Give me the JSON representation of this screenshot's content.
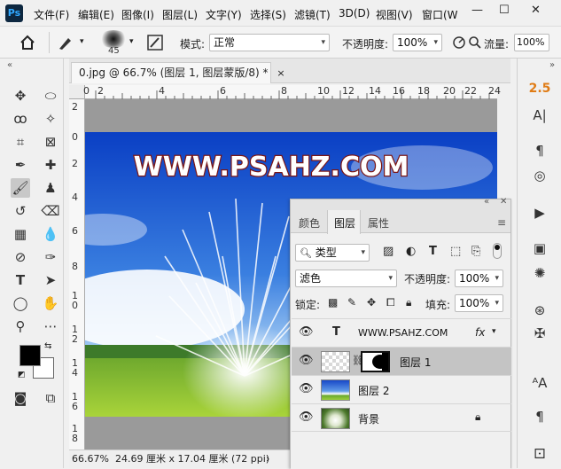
{
  "menubar": {
    "logo": "Ps",
    "items": [
      "文件(F)",
      "编辑(E)",
      "图像(I)",
      "图层(L)",
      "文字(Y)",
      "选择(S)",
      "滤镜(T)",
      "3D(D)",
      "视图(V)",
      "窗口(W"
    ],
    "min": "—",
    "max": "☐",
    "close": "✕"
  },
  "options": {
    "brush_size": "45",
    "mode_label": "模式:",
    "mode_value": "正常",
    "opacity_label": "不透明度:",
    "opacity_value": "100%",
    "flow_label": "流量:",
    "flow_value": "100%"
  },
  "document": {
    "tab_title": "0.jpg @ 66.7% (图层 1, 图层蒙版/8) *",
    "canvas_text": "WWW.PSAHZ.COM",
    "ruler_h": [
      "0",
      "2",
      "4",
      "6",
      "8",
      "10",
      "12",
      "14",
      "16",
      "18",
      "20",
      "22",
      "24"
    ],
    "ruler_v": [
      "2",
      "0",
      "2",
      "4",
      "6",
      "8",
      "1\n0",
      "1\n2",
      "1\n4",
      "1\n6",
      "1\n8"
    ]
  },
  "status": {
    "zoom": "66.67%",
    "info": "24.69 厘米 x 17.04 厘米 (72 ppi)",
    "arrow": "›"
  },
  "right_panel": {
    "value_label": "2.5"
  },
  "layers_panel": {
    "tabs": [
      "颜色",
      "图层",
      "属性"
    ],
    "filter_label": "类型",
    "blend_mode": "滤色",
    "opacity_label": "不透明度:",
    "opacity_value": "100%",
    "lock_label": "锁定:",
    "fill_label": "填充:",
    "fill_value": "100%",
    "layers": [
      {
        "name": "WWW.PSAHZ.COM",
        "kind": "text",
        "fx": "fx"
      },
      {
        "name": "图层 1",
        "kind": "masked",
        "selected": true
      },
      {
        "name": "图层 2",
        "kind": "image"
      },
      {
        "name": "背景",
        "kind": "background",
        "locked": true
      }
    ]
  },
  "colors": {
    "accent_orange": "#e07c16",
    "selected_row": "#c4c4c4",
    "text_outline": "#8b1a1a"
  }
}
